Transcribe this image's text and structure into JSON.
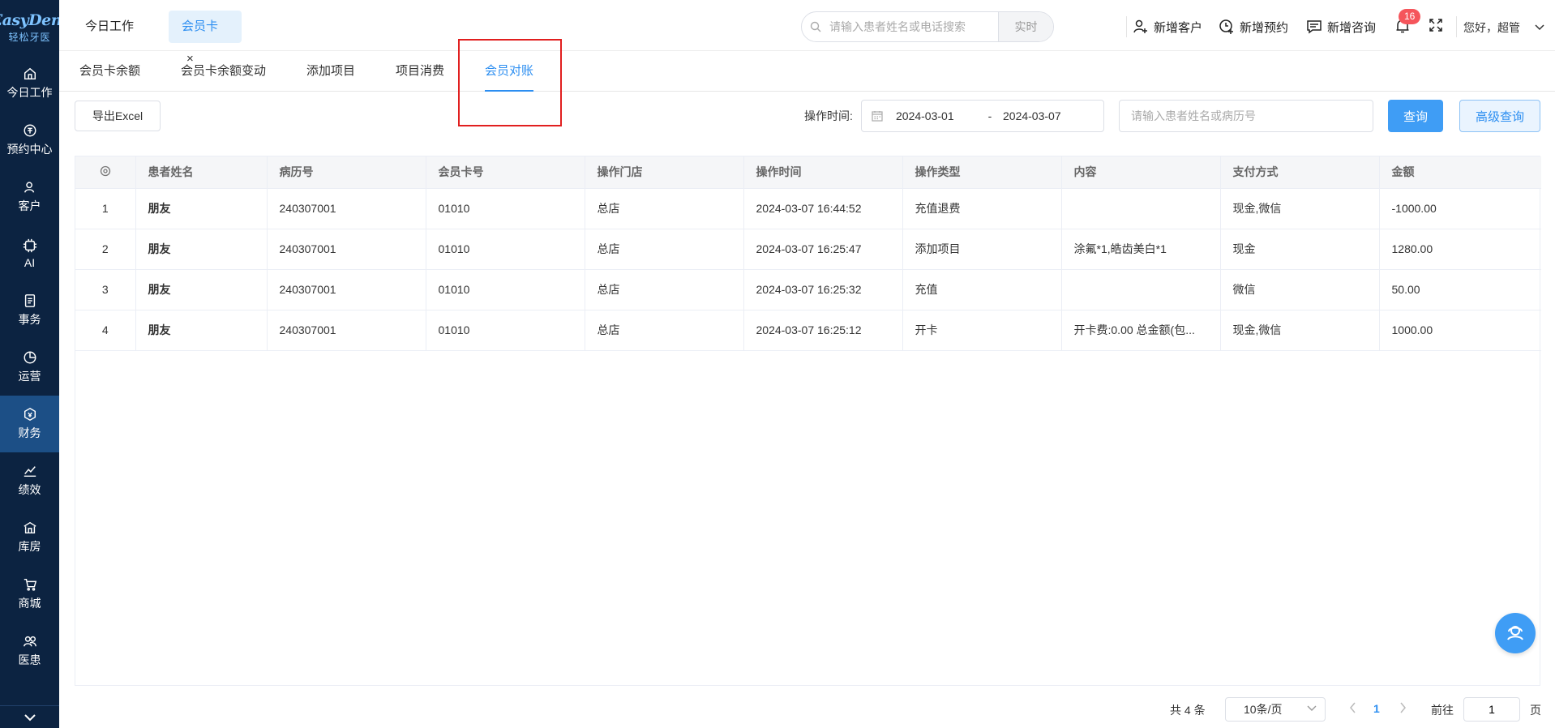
{
  "brand": {
    "name": "EasyDent",
    "subtitle": "轻松牙医"
  },
  "sidebar": {
    "items": [
      {
        "label": "今日工作",
        "icon": "home-icon"
      },
      {
        "label": "预约中心",
        "icon": "appointment-icon"
      },
      {
        "label": "客户",
        "icon": "customer-icon"
      },
      {
        "label": "AI",
        "icon": "ai-icon"
      },
      {
        "label": "事务",
        "icon": "tasks-icon"
      },
      {
        "label": "运营",
        "icon": "operations-icon"
      },
      {
        "label": "财务",
        "icon": "finance-icon"
      },
      {
        "label": "绩效",
        "icon": "performance-icon"
      },
      {
        "label": "库房",
        "icon": "warehouse-icon"
      },
      {
        "label": "商城",
        "icon": "mall-icon"
      },
      {
        "label": "医患",
        "icon": "doctor-patient-icon"
      }
    ],
    "active": "财务"
  },
  "header": {
    "tabs": [
      {
        "label": "今日工作"
      },
      {
        "label": "会员卡"
      }
    ],
    "search_placeholder": "请输入患者姓名或电话搜索",
    "search_mode": "实时",
    "actions": {
      "new_customer": "新增客户",
      "new_appointment": "新增预约",
      "new_consult": "新增咨询"
    },
    "notification_count": "16",
    "greeting": "您好，超管"
  },
  "subtabs": [
    {
      "label": "会员卡余额"
    },
    {
      "label": "会员卡余额变动"
    },
    {
      "label": "添加项目"
    },
    {
      "label": "项目消费"
    },
    {
      "label": "会员对账"
    }
  ],
  "toolbar": {
    "export_label": "导出Excel",
    "op_time_label": "操作时间:",
    "date_start": "2024-03-01",
    "date_sep": "-",
    "date_end": "2024-03-07",
    "query_placeholder": "请输入患者姓名或病历号",
    "query_label": "查询",
    "advanced_label": "高级查询"
  },
  "table": {
    "columns": [
      "",
      "患者姓名",
      "病历号",
      "会员卡号",
      "操作门店",
      "操作时间",
      "操作类型",
      "内容",
      "支付方式",
      "金额"
    ],
    "rows": [
      [
        "1",
        "朋友",
        "240307001",
        "01010",
        "总店",
        "2024-03-07 16:44:52",
        "充值退费",
        "",
        "现金,微信",
        "-1000.00"
      ],
      [
        "2",
        "朋友",
        "240307001",
        "01010",
        "总店",
        "2024-03-07 16:25:47",
        "添加项目",
        "涂氟*1,皓齿美白*1",
        "现金",
        "1280.00"
      ],
      [
        "3",
        "朋友",
        "240307001",
        "01010",
        "总店",
        "2024-03-07 16:25:32",
        "充值",
        "",
        "微信",
        "50.00"
      ],
      [
        "4",
        "朋友",
        "240307001",
        "01010",
        "总店",
        "2024-03-07 16:25:12",
        "开卡",
        "开卡费:0.00 总金额(包...",
        "现金,微信",
        "1000.00"
      ]
    ]
  },
  "pagination": {
    "total": "共 4 条",
    "page_size": "10条/页",
    "current": "1",
    "goto_label": "前往",
    "goto_value": "1",
    "page_suffix": "页"
  },
  "colors": {
    "accent": "#2c8ef1",
    "sidebar_bg": "#0c2341",
    "highlight": "#e11f1f",
    "badge": "#f5555b"
  }
}
